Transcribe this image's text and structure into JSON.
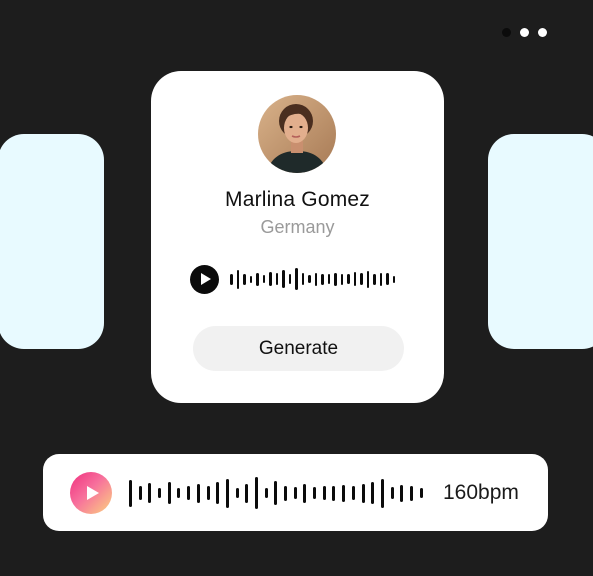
{
  "menu": {
    "icon": "more-dots-icon"
  },
  "profile": {
    "name": "Marlina Gomez",
    "country": "Germany",
    "avatar_icon": "avatar",
    "play_icon": "play-icon",
    "waveform_heights": [
      0.45,
      0.8,
      0.45,
      0.3,
      0.55,
      0.35,
      0.6,
      0.5,
      0.75,
      0.4,
      0.9,
      0.5,
      0.35,
      0.55,
      0.45,
      0.4,
      0.55,
      0.45,
      0.4,
      0.6,
      0.5,
      0.7,
      0.45,
      0.55,
      0.5,
      0.3
    ],
    "generate_label": "Generate"
  },
  "player": {
    "play_icon": "play-icon",
    "bpm": "160bpm",
    "waveform_heights": [
      0.8,
      0.4,
      0.6,
      0.3,
      0.65,
      0.3,
      0.4,
      0.55,
      0.4,
      0.65,
      0.85,
      0.3,
      0.55,
      0.95,
      0.3,
      0.7,
      0.45,
      0.35,
      0.55,
      0.35,
      0.4,
      0.45,
      0.5,
      0.4,
      0.55,
      0.65,
      0.85,
      0.35,
      0.5,
      0.45,
      0.3
    ]
  },
  "colors": {
    "background": "#1d1d1d",
    "side_card": "#e8faff",
    "play_gradient_start": "#f0307f",
    "play_gradient_end": "#fbd37f"
  }
}
